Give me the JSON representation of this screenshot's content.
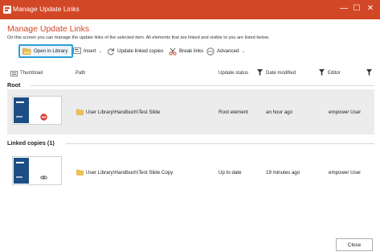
{
  "window": {
    "title": "Manage Update Links",
    "controls": [
      "—",
      "☐",
      "✕"
    ]
  },
  "heading": "Manage Update Links",
  "description": "On this screen you can manage the update links of the selected item. All elements that are linked and visible to you are listed below.",
  "toolbar": {
    "open_in_library": "Open in Library",
    "insert": "Insert",
    "update_linked_copies": "Update linked copies",
    "break_links": "Break links",
    "advanced": "Advanced"
  },
  "columns": {
    "thumbnail": "Thumbnail",
    "path": "Path",
    "update_status": "Update status",
    "date_modified": "Date modified",
    "editor": "Editor"
  },
  "sections": {
    "root": {
      "title": "Root",
      "rows": [
        {
          "path": "User Library\\Handbuch\\Test Slide",
          "update_status": "Root element",
          "date_modified": "an hour ago",
          "editor": "empower User",
          "thumb_title": "Test Slide",
          "badge_icon": "no-entry-icon"
        }
      ]
    },
    "linked": {
      "title": "Linked copies (1)",
      "rows": [
        {
          "path": "User Library\\Handbuch\\Test Slide Copy",
          "update_status": "Up to date",
          "date_modified": "19 minutes ago",
          "editor": "empower User",
          "thumb_title": "Test Slide",
          "badge_icon": "link-icon"
        }
      ]
    }
  },
  "footer": {
    "close": "Close"
  },
  "colors": {
    "accent": "#d24726",
    "focus": "#2c9fd9",
    "selected_row": "#ececec",
    "slide_panel": "#1d4d85",
    "folder": "#f2c14e"
  }
}
